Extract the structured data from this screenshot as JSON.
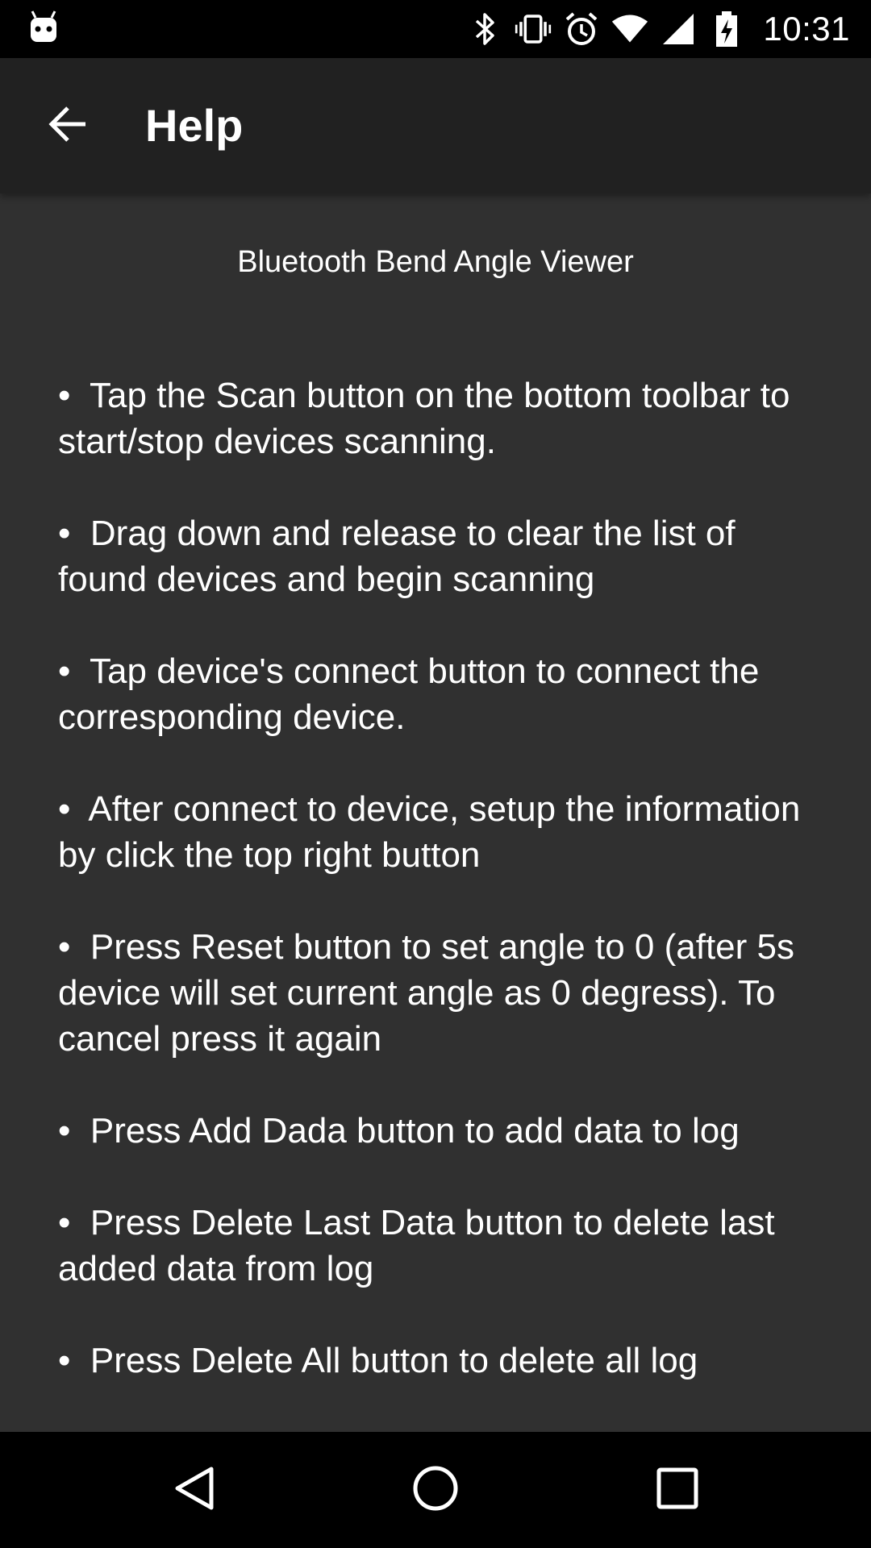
{
  "status_bar": {
    "time": "10:31",
    "icons": [
      "android-icon",
      "bluetooth-icon",
      "vibrate-icon",
      "alarm-icon",
      "wifi-icon",
      "cell-signal-icon",
      "battery-charging-icon"
    ]
  },
  "app_bar": {
    "title": "Help",
    "back_icon": "arrow-back-icon"
  },
  "content": {
    "heading": "Bluetooth Bend Angle Viewer",
    "items": [
      "•  Tap the Scan button on the bottom toolbar to start/stop devices scanning.",
      "•  Drag down and release to clear the list of found devices and begin scanning",
      "•  Tap device's connect button to connect the corresponding device.",
      "•  After connect to device, setup the information by click the top right button",
      "•  Press Reset button to set angle to 0 (after 5s device will set current angle as 0 degress). To cancel press it again",
      "•  Press Add Dada button to add data to log",
      "•  Press Delete Last Data button to delete last added data from log",
      "•  Press Delete All button to delete all log"
    ]
  },
  "nav_bar": {
    "icons": [
      "back-triangle-icon",
      "home-circle-icon",
      "recents-square-icon"
    ]
  },
  "colors": {
    "status_bar": "#000000",
    "app_bar": "#212121",
    "background": "#303030",
    "text": "#ffffff",
    "nav_bar": "#000000"
  }
}
